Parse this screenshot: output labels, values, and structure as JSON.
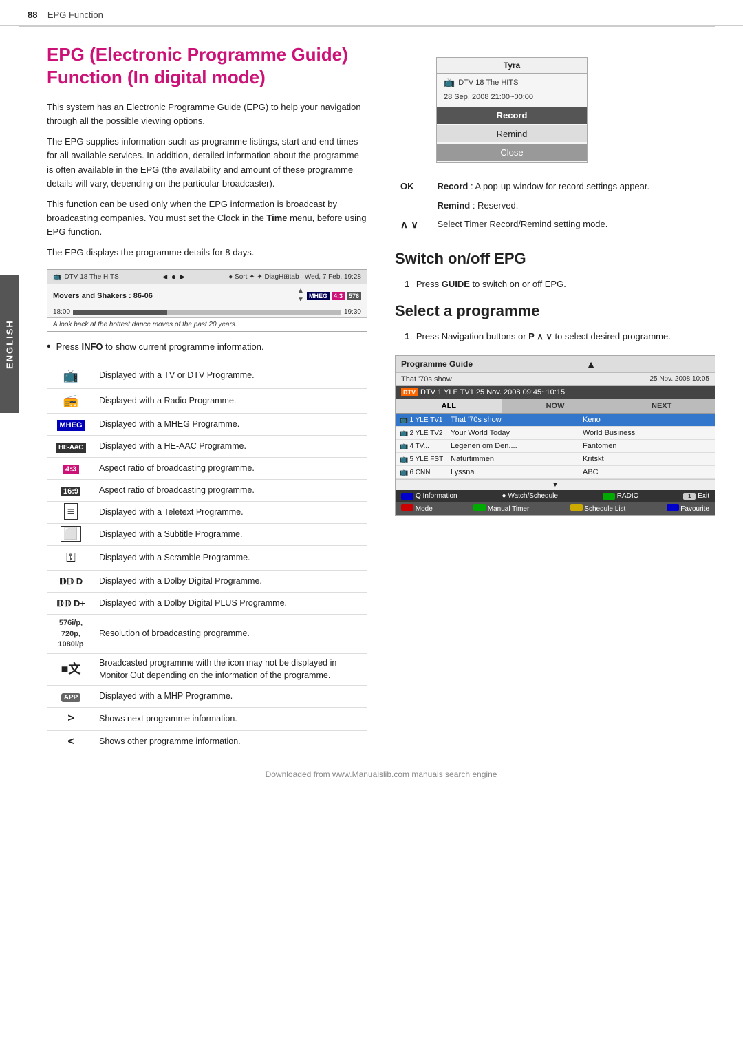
{
  "header": {
    "page_number": "88",
    "section": "EPG Function"
  },
  "sidebar": {
    "label": "ENGLISH"
  },
  "left": {
    "title": "EPG (Electronic Programme Guide) Function (In digital mode)",
    "paragraphs": [
      "This system has an Electronic Programme Guide (EPG) to help your navigation through all the possible viewing options.",
      "The EPG supplies information such as programme listings, start and end times for all available services. In addition, detailed information about the programme is often available in the EPG (the availability and amount of these programme details will vary, depending on the particular broadcaster).",
      "This function can be used only when the EPG information is broadcast by broadcasting companies. You must set the Clock in the Time menu, before using EPG function.",
      "The EPG displays the programme details for 8 days."
    ],
    "epg_screenshot": {
      "channel": "DTV 18 The HITS",
      "programme": "Movers and Shakers : 86-06",
      "time_start": "18:00",
      "time_end": "19:30",
      "date": "Wed, 7 Feb, 19:28",
      "badges": [
        "MHEG",
        "4:3",
        "576"
      ],
      "description": "A look back at the hottest dance moves of the past 20 years."
    },
    "info_bullet": "Press INFO to show current programme information.",
    "icons": [
      {
        "icon_type": "tv",
        "icon_display": "📺",
        "description": "Displayed with a TV or DTV Programme."
      },
      {
        "icon_type": "radio",
        "icon_display": "📻",
        "description": "Displayed with a Radio Programme."
      },
      {
        "icon_type": "mheg",
        "icon_display": "MHEG",
        "description": "Displayed with a MHEG Programme."
      },
      {
        "icon_type": "he-aac",
        "icon_display": "HE-AAC",
        "description": "Displayed with a HE-AAC Programme."
      },
      {
        "icon_type": "4:3",
        "icon_display": "4:3",
        "description": "Aspect ratio of broadcasting programme."
      },
      {
        "icon_type": "16:9",
        "icon_display": "16:9",
        "description": "Aspect ratio of broadcasting programme."
      },
      {
        "icon_type": "teletext",
        "icon_display": "≡",
        "description": "Displayed with a Teletext Programme."
      },
      {
        "icon_type": "subtitle",
        "icon_display": "⊡",
        "description": "Displayed with a Subtitle Programme."
      },
      {
        "icon_type": "scramble",
        "icon_display": "✖",
        "description": "Displayed with a Scramble Programme."
      },
      {
        "icon_type": "dolby",
        "icon_display": "DD D",
        "description": "Displayed with a Dolby Digital Programme."
      },
      {
        "icon_type": "dolby-plus",
        "icon_display": "DD D+",
        "description": "Displayed with a Dolby Digital PLUS Programme."
      },
      {
        "icon_type": "resolution",
        "icon_display": "576i/p,\n720p,\n1080i/p",
        "description": "Resolution of broadcasting programme."
      },
      {
        "icon_type": "monitor-out",
        "icon_display": "■文",
        "description": "Broadcasted programme with the icon may not be displayed in Monitor Out depending on the information of the programme."
      },
      {
        "icon_type": "app",
        "icon_display": "APP",
        "description": "Displayed with a MHP Programme."
      },
      {
        "icon_type": "arrow-right",
        "icon_display": ">",
        "description": "Shows next programme information."
      },
      {
        "icon_type": "arrow-down",
        "icon_display": "<",
        "description": "Shows other programme information."
      }
    ]
  },
  "right": {
    "popup": {
      "title": "Tyra",
      "channel": "DTV 18 The HITS",
      "date_time": "28 Sep. 2008 21:00~00:00",
      "buttons": [
        "Record",
        "Remind",
        "Close"
      ]
    },
    "ok_table": [
      {
        "key": "OK",
        "description_bold": "Record",
        "description_rest": " : A pop-up window for record settings appear."
      },
      {
        "key": "",
        "description_bold": "Remind",
        "description_rest": " : Reserved."
      },
      {
        "key": "∧ ∨",
        "description_bold": "",
        "description_rest": "Select Timer Record/Remind setting mode."
      }
    ],
    "switch_section": {
      "title": "Switch on/off EPG",
      "step1": "Press GUIDE to switch on or off EPG."
    },
    "select_section": {
      "title": "Select a programme",
      "step1": "Press Navigation buttons or P ∧ ∨ to select desired programme."
    },
    "programme_guide": {
      "title": "Programme Guide",
      "show": "That '70s show",
      "date_right": "25 Nov. 2008 10:05",
      "channel_bar": "DTV 1 YLE TV1 25 Nov. 2008 09:45~10:15",
      "tabs": [
        "ALL",
        "NOW",
        "NEXT"
      ],
      "rows": [
        {
          "num": "1",
          "channel": "YLE TV1",
          "now": "That '70s show",
          "next": "Keno",
          "highlighted": true
        },
        {
          "num": "2",
          "channel": "YLE TV2",
          "now": "Your World Today",
          "next": "World Business",
          "highlighted": false
        },
        {
          "num": "4",
          "channel": "TV...",
          "now": "Legenen om Den....",
          "next": "Fantomen",
          "highlighted": false
        },
        {
          "num": "5",
          "channel": "YLE FST",
          "now": "Naturtimmen",
          "next": "Kritskt",
          "highlighted": false
        },
        {
          "num": "6",
          "channel": "CNN",
          "now": "Lyssna",
          "next": "ABC",
          "highlighted": false
        }
      ],
      "bottom1": {
        "info": "INFO Q Information",
        "watch": "● Watch/Schedule",
        "radio": "RADIO",
        "exit": "Exit"
      },
      "bottom2": {
        "mode": "Mode",
        "manual_timer": "Manual Timer",
        "schedule_list": "Schedule List",
        "favourite": "Favourite"
      }
    }
  },
  "footer": {
    "text": "Downloaded from www.Manualslib.com manuals search engine"
  }
}
